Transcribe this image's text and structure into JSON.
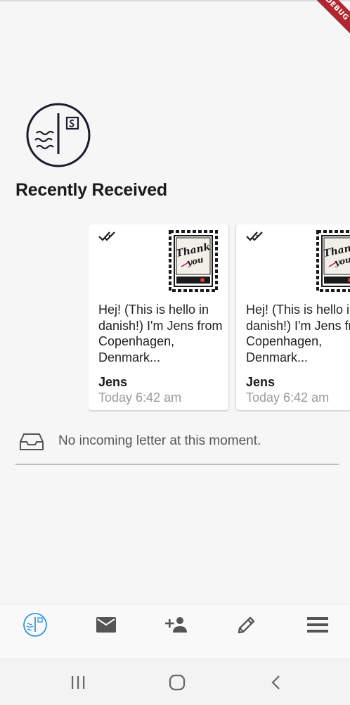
{
  "debug_banner": "DEBUG",
  "section": {
    "title": "Recently Received"
  },
  "letters": [
    {
      "message": "Hej! (This is hello in danish!) I'm Jens from Copenhagen, Denmark...",
      "sender": "Jens",
      "time": "Today 6:42 am",
      "stamp_icon": "thank-you-stamp",
      "status_icon": "double-check-icon"
    },
    {
      "message": "Hej! (This is hello in danish!) I'm Jens from Copenhagen, Denmark...",
      "sender": "Jens",
      "time": "Today 6:42 am",
      "stamp_icon": "thank-you-stamp",
      "status_icon": "double-check-icon"
    }
  ],
  "incoming": {
    "empty_text": "No incoming letter at this moment.",
    "icon": "inbox-icon"
  },
  "bottom_nav": [
    {
      "name": "home",
      "icon": "app-logo-icon",
      "active": true
    },
    {
      "name": "mail",
      "icon": "mail-icon",
      "active": false
    },
    {
      "name": "add-friend",
      "icon": "person-add-icon",
      "active": false
    },
    {
      "name": "write",
      "icon": "pencil-icon",
      "active": false
    },
    {
      "name": "menu",
      "icon": "menu-icon",
      "active": false
    }
  ],
  "system_nav": [
    "recents-icon",
    "home-icon",
    "back-icon"
  ],
  "colors": {
    "accent": "#1e88e5",
    "icon": "#555555",
    "logo": "#1b1b2b",
    "ribbon": "#b2262f"
  }
}
